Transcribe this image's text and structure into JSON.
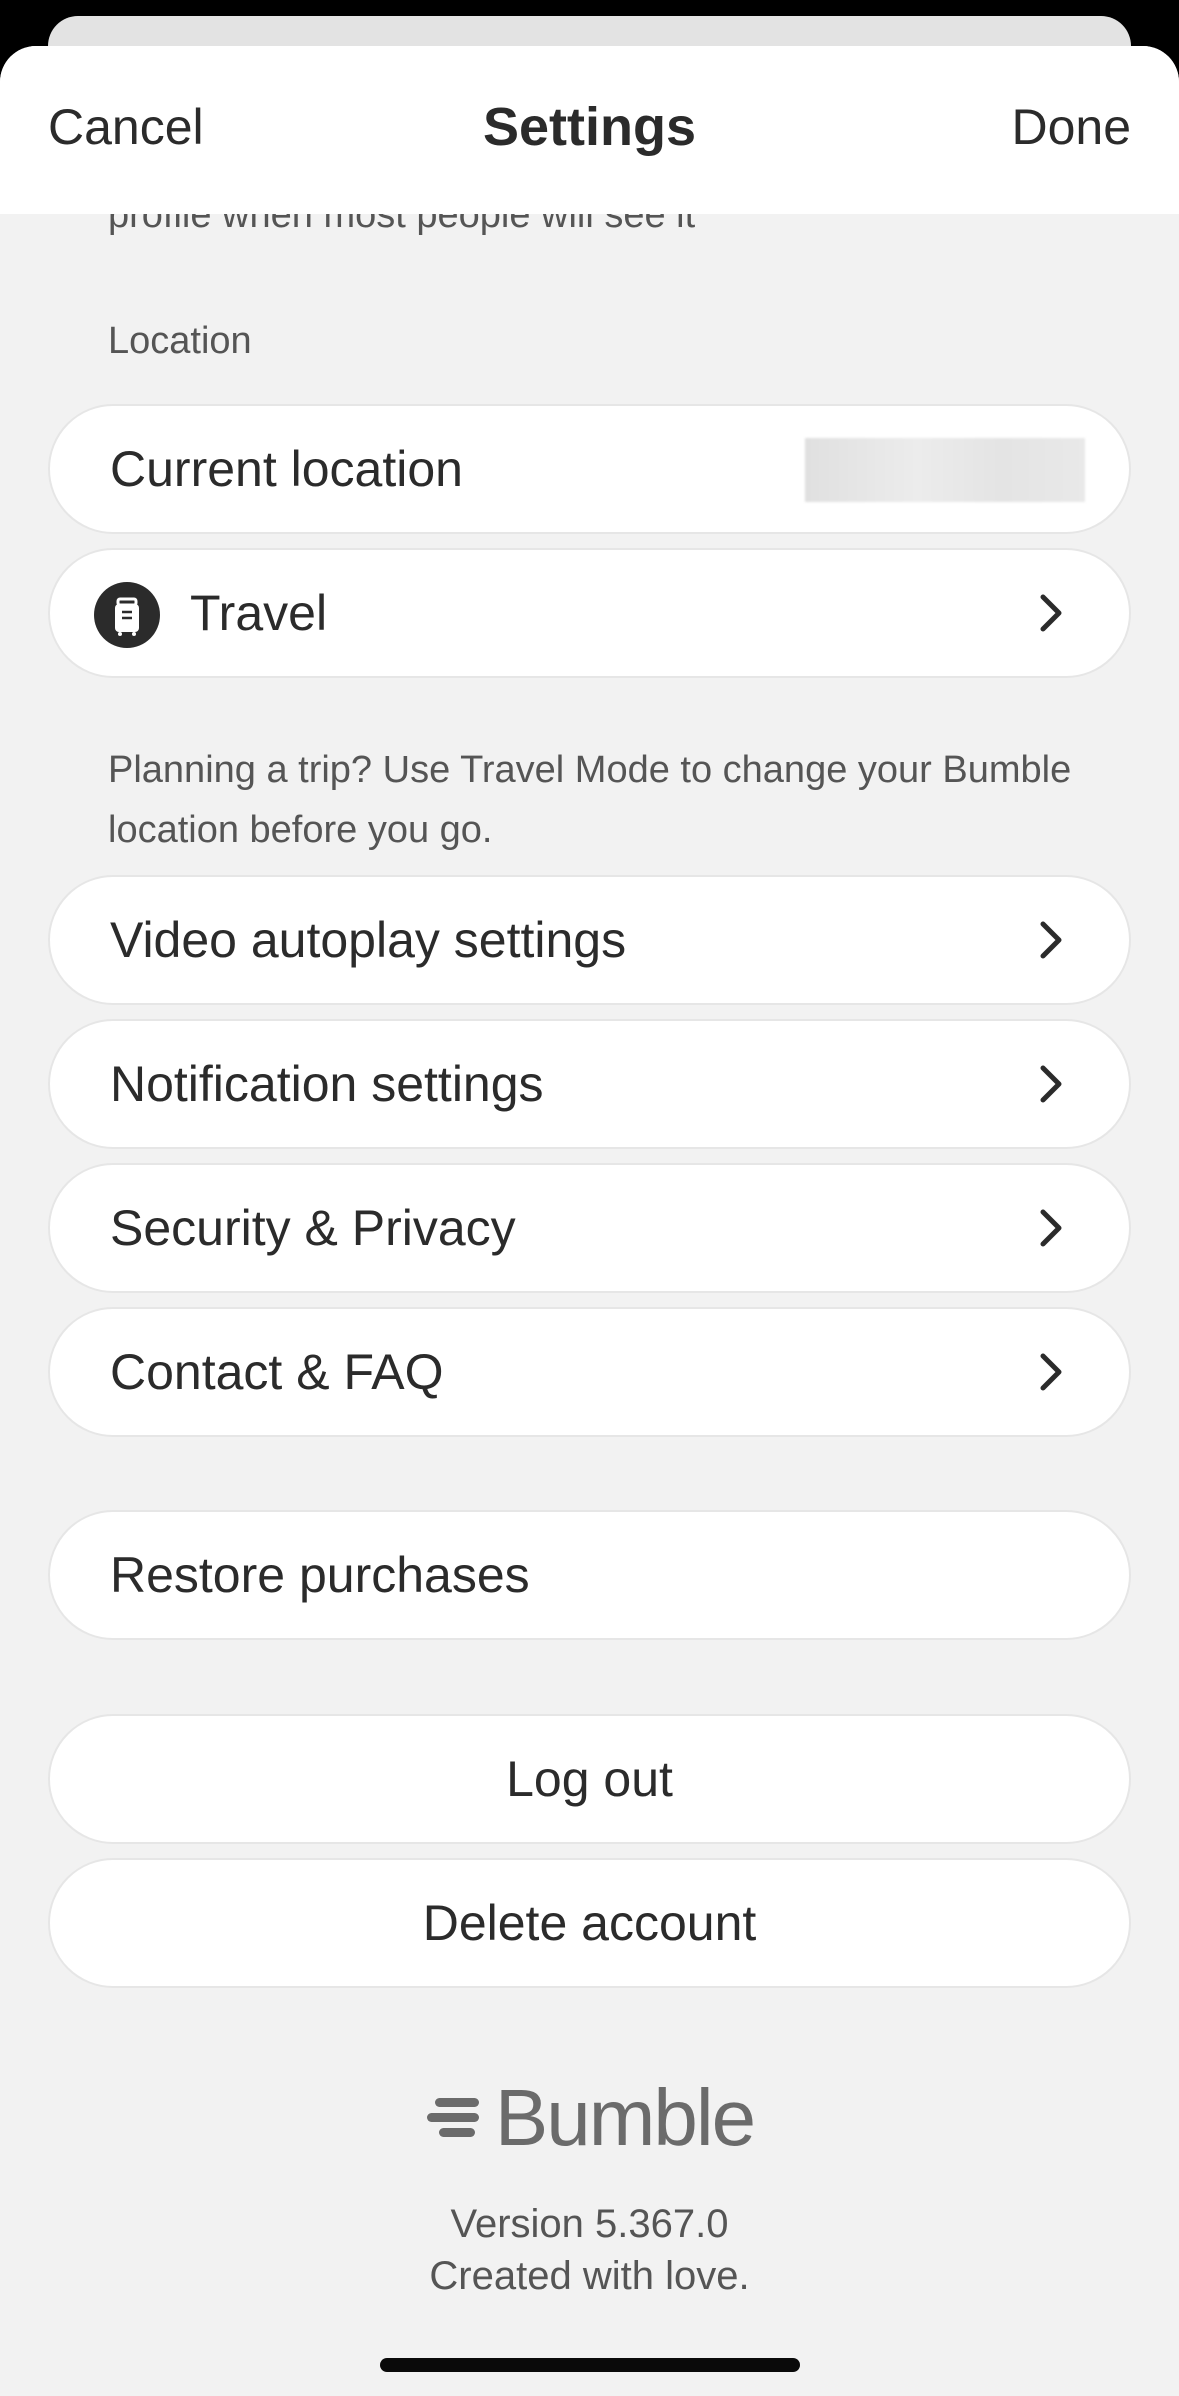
{
  "header": {
    "cancel_label": "Cancel",
    "title": "Settings",
    "done_label": "Done"
  },
  "cut_off_text": "profile when most people will see it",
  "location_section": {
    "label": "Location",
    "current_location_label": "Current location",
    "travel_label": "Travel",
    "travel_description": "Planning a trip? Use Travel Mode to change your Bumble location before you go."
  },
  "menu": {
    "video_autoplay": "Video autoplay settings",
    "notifications": "Notification settings",
    "security_privacy": "Security & Privacy",
    "contact_faq": "Contact & FAQ"
  },
  "restore_purchases": "Restore purchases",
  "log_out": "Log out",
  "delete_account": "Delete account",
  "footer": {
    "brand": "Bumble",
    "version": "Version 5.367.0",
    "tagline": "Created with love."
  },
  "icons": {
    "travel": "suitcase-icon",
    "row_arrow": "chevron-right-icon",
    "brand_mark": "bumble-logo-icon"
  },
  "colors": {
    "background": "#f2f2f2",
    "row_background": "#ffffff",
    "text": "#2b2b2b",
    "secondary_text": "#555555",
    "brand_gray": "#6b6b6b"
  }
}
